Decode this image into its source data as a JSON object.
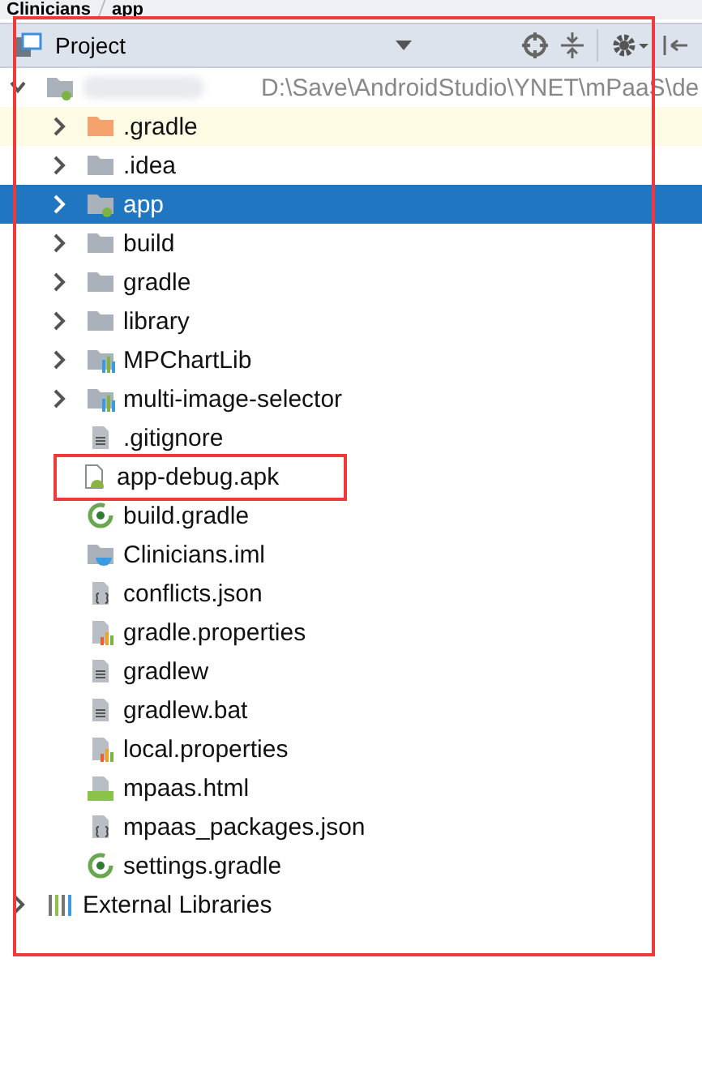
{
  "breadcrumbs": [
    {
      "label": "Clinicians"
    },
    {
      "label": "app"
    }
  ],
  "panel": {
    "title": "Project",
    "boxed": true
  },
  "tree": {
    "path": "D:\\Save\\AndroidStudio\\YNET\\mPaaS\\de",
    "kind": "module",
    "expanded": true,
    "selected": false,
    "highlighted": false,
    "boxed": false,
    "children": [
      {
        "name": ".gradle",
        "kind": "excluded-folder",
        "expanded": false,
        "selected": false,
        "highlighted": true,
        "boxed": false
      },
      {
        "name": ".idea",
        "kind": "folder",
        "expanded": false,
        "selected": false,
        "highlighted": false,
        "boxed": false
      },
      {
        "name": "app",
        "kind": "module",
        "expanded": false,
        "selected": true,
        "highlighted": false,
        "boxed": false
      },
      {
        "name": "build",
        "kind": "folder",
        "expanded": false,
        "selected": false,
        "highlighted": false,
        "boxed": false
      },
      {
        "name": "gradle",
        "kind": "folder",
        "expanded": false,
        "selected": false,
        "highlighted": false,
        "boxed": false
      },
      {
        "name": "library",
        "kind": "folder",
        "expanded": false,
        "selected": false,
        "highlighted": false,
        "boxed": false
      },
      {
        "name": "MPChartLib",
        "kind": "library",
        "expanded": false,
        "selected": false,
        "highlighted": false,
        "boxed": false
      },
      {
        "name": "multi-image-selector",
        "kind": "library",
        "expanded": false,
        "selected": false,
        "highlighted": false,
        "boxed": false
      },
      {
        "name": ".gitignore",
        "kind": "text",
        "selected": false,
        "highlighted": false,
        "boxed": false
      },
      {
        "name": "app-debug.apk",
        "kind": "apk",
        "selected": false,
        "highlighted": false,
        "boxed": true
      },
      {
        "name": "build.gradle",
        "kind": "gradle",
        "selected": false,
        "highlighted": false,
        "boxed": false
      },
      {
        "name": "Clinicians.iml",
        "kind": "iml",
        "selected": false,
        "highlighted": false,
        "boxed": false
      },
      {
        "name": "conflicts.json",
        "kind": "json",
        "selected": false,
        "highlighted": false,
        "boxed": false
      },
      {
        "name": "gradle.properties",
        "kind": "properties",
        "selected": false,
        "highlighted": false,
        "boxed": false
      },
      {
        "name": "gradlew",
        "kind": "text",
        "selected": false,
        "highlighted": false,
        "boxed": false
      },
      {
        "name": "gradlew.bat",
        "kind": "text",
        "selected": false,
        "highlighted": false,
        "boxed": false
      },
      {
        "name": "local.properties",
        "kind": "properties",
        "selected": false,
        "highlighted": false,
        "boxed": false
      },
      {
        "name": "mpaas.html",
        "kind": "html",
        "selected": false,
        "highlighted": false,
        "boxed": false
      },
      {
        "name": "mpaas_packages.json",
        "kind": "json",
        "selected": false,
        "highlighted": false,
        "boxed": false
      },
      {
        "name": "settings.gradle",
        "kind": "gradle",
        "selected": false,
        "highlighted": false,
        "boxed": false
      }
    ]
  },
  "roots": [
    {
      "name": "External Libraries",
      "kind": "libraries",
      "expanded": false,
      "selected": false,
      "highlighted": false,
      "boxed": false
    }
  ]
}
